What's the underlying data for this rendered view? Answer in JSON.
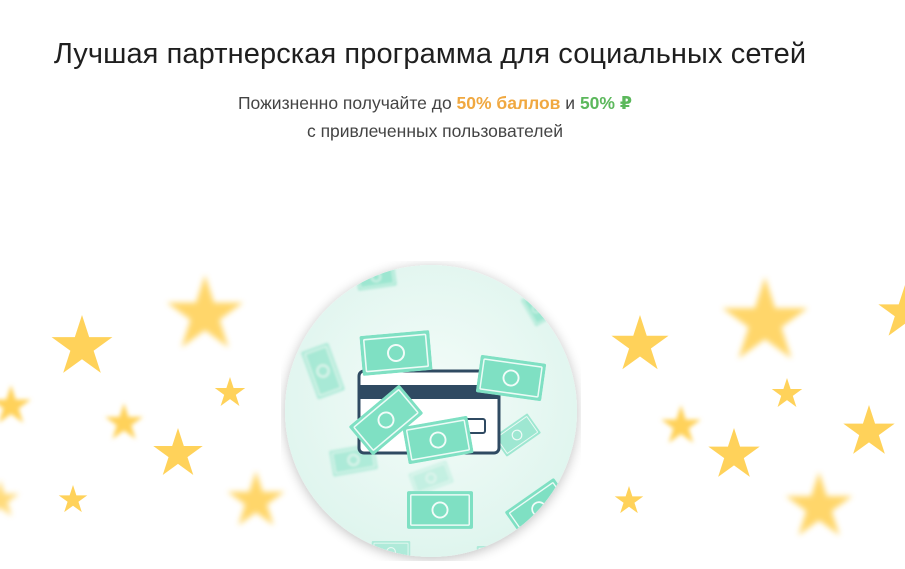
{
  "hero": {
    "title": "Лучшая партнерская программа для социальных сетей",
    "subtitle_prefix": "Пожизненно получайте до ",
    "highlight_points": "50% баллов",
    "subtitle_and": " и ",
    "highlight_rub": "50% ₽",
    "subtitle_line2": "с привлеченных пользователей"
  },
  "illustration": {
    "icon": "card-with-banknotes-icon",
    "star_icon": "star-icon"
  },
  "colors": {
    "orange": "#f0a840",
    "green": "#5cb85c",
    "star": "#ffd25a",
    "circle_bg": "#e9faf4",
    "banknote": "#7fe0c3",
    "card_stripe": "#2f4a62"
  }
}
